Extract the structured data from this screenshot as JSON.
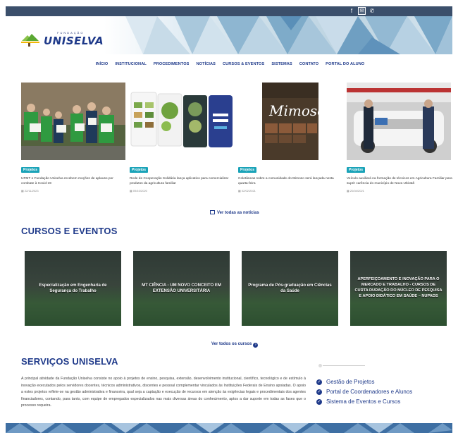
{
  "topbar": {
    "icons": [
      "facebook-icon",
      "mail-icon",
      "phone-icon"
    ],
    "facebook_glyph": "f",
    "mail_glyph": "✉",
    "phone_glyph": "✆"
  },
  "brand": {
    "logo_small": "FUNDAÇÃO",
    "logo_text": "UNISELVA"
  },
  "nav": {
    "items": [
      "INÍCIO",
      "INSTITUCIONAL",
      "PROCEDIMENTOS",
      "NOTÍCIAS",
      "CURSOS & EVENTOS",
      "SISTEMAS",
      "CONTATO",
      "PORTAL DO ALUNO"
    ]
  },
  "news": [
    {
      "tag": "Projetos",
      "text": "UFMT e Fundação Uniselva recebem moções de aplauso por combate à Covid-19",
      "date": "22/11/2023"
    },
    {
      "tag": "Projetos",
      "text": "Rede de Cooperação Solidária lança aplicativo para comercializar produtos da agricultura familiar",
      "date": "09/10/2020"
    },
    {
      "tag": "Projetos",
      "text": "Coletâneas sobre a comunidade do Mimoso será lançada nesta quarta-feira",
      "date": "02/02/2021"
    },
    {
      "tag": "Projetos",
      "text": "Veículo auxiliará na formação de técnicos em Agricultura Familiar para suprir carência do município de Nova Ubiratã",
      "date": "20/04/2021"
    }
  ],
  "news_book_title": "Mimoso",
  "all_news_label": "Ver todas as notícias",
  "courses_title": "CURSOS E EVENTOS",
  "courses": [
    "Especialização em Engenharia de Segurança do Trabalho",
    "MT CIÊNCIA - UM NOVO CONCEITO EM EXTENSÃO UNIVERSITÁRIA",
    "Programa de Pós-graduação em Ciências da Saúde",
    "APERFEIÇOAMENTO E INOVAÇÃO PARA O MERCADO E TRABALHO - CURSOS DE CURTA DURAÇÃO DO NÚCLEO DE PESQUISA E APOIO DIDÁTICO EM SAÚDE – NUPADS"
  ],
  "all_courses_label": "Ver todos os cursos",
  "services_title": "SERVIÇOS UNISELVA",
  "services_text": "A principal atividade da Fundação Uniselva consiste no apoio à projetos de ensino, pesquisa, extensão, desenvolvimento institucional, científico, tecnológico e de estímulo à inovação executados pelos servidores docentes, técnicos administrativos, discentes e pessoal complementar vinculados às Instituições Federais de Ensino apoiadas. O apoio a estes projetos reflete-se na gestão administrativa e financeira, qual seja a captação e execução de recursos em atenção às exigências legais e procedimentais dos agentes financiadores, contando, para tanto, com equipe de empregados especializados nas mais diversas áreas do conhecimento, aptos a dar suporte em todas as fases que o processo requeira.",
  "services_links": [
    "Gestão de Projetos",
    "Portal de Coordenadores e Alunos",
    "Sistema de Eventos e Cursos"
  ],
  "colors": {
    "brand_blue": "#1f3a8a",
    "tag_teal": "#1aa3b8",
    "topbar": "#3b4f6b"
  }
}
